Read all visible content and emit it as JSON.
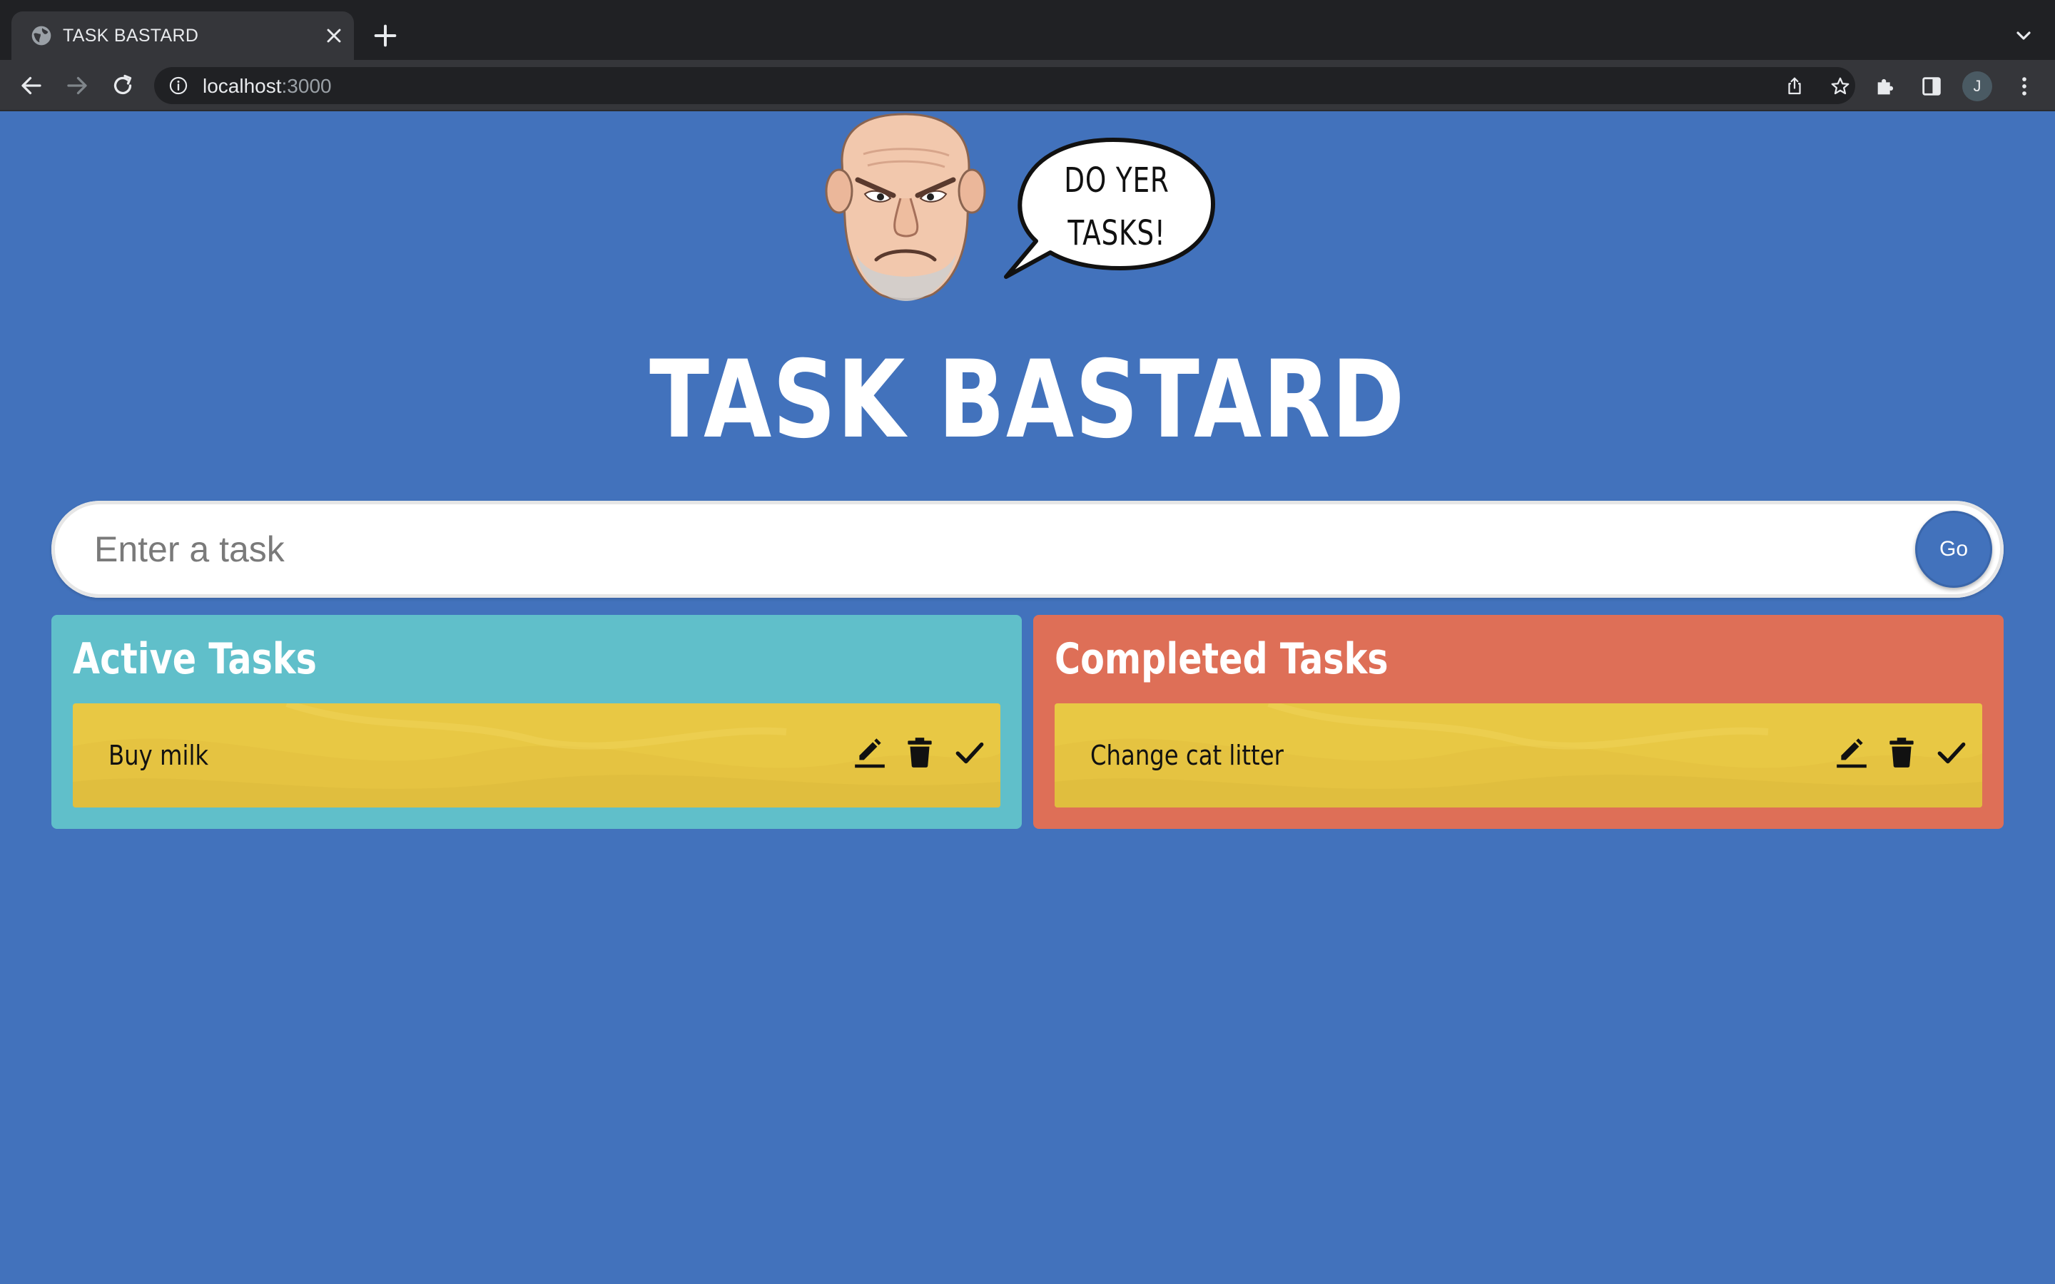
{
  "browser": {
    "tab_title": "TASK BASTARD",
    "url_host": "localhost",
    "url_port": ":3000",
    "profile_initial": "J"
  },
  "app": {
    "speech_bubble_line1": "DO YER",
    "speech_bubble_line2": "TASKS!",
    "title": "TASK BASTARD"
  },
  "task_form": {
    "placeholder": "Enter a task",
    "value": "",
    "submit_label": "Go"
  },
  "columns": {
    "active": {
      "heading": "Active Tasks",
      "color": "#60bfca",
      "tasks": [
        {
          "text": "Buy milk"
        }
      ]
    },
    "completed": {
      "heading": "Completed Tasks",
      "color": "#de6f57",
      "tasks": [
        {
          "text": "Change cat litter"
        }
      ]
    }
  },
  "colors": {
    "page_background": "#4272bc",
    "task_card": "#e8c844",
    "go_button": "#4272bc"
  }
}
